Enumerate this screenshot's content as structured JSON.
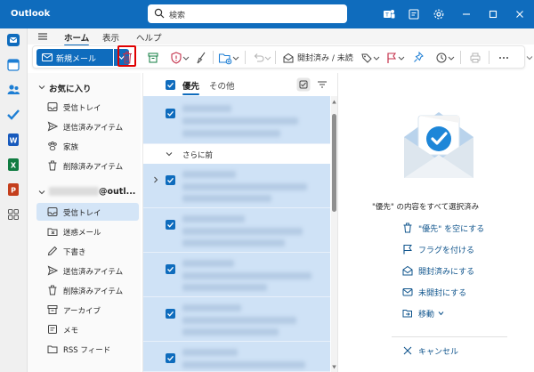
{
  "app": {
    "title": "Outlook"
  },
  "search": {
    "placeholder": "検索"
  },
  "ribbon": {
    "tabs": [
      "ホーム",
      "表示",
      "ヘルプ"
    ]
  },
  "toolbar": {
    "new_mail_label": "新規メール",
    "read_unread_label": "開封済み / 未読"
  },
  "folders": {
    "favorites_label": "お気に入り",
    "favorites": [
      "受信トレイ",
      "送信済みアイテム",
      "家族",
      "削除済みアイテム"
    ],
    "account_suffix": "@outl...",
    "account_items": [
      "受信トレイ",
      "迷惑メール",
      "下書き",
      "送信済みアイテム",
      "削除済みアイテム",
      "アーカイブ",
      "メモ",
      "RSS フィード"
    ]
  },
  "list": {
    "tabs": [
      "優先",
      "その他"
    ],
    "section_label": "さらに前"
  },
  "reading": {
    "selected_message": "\"優先\" の内容をすべて選択済み",
    "actions": {
      "empty": "\"優先\" を空にする",
      "flag": "フラグを付ける",
      "mark_read": "開封済みにする",
      "mark_unread": "未開封にする",
      "move": "移動",
      "cancel": "キャンセル"
    }
  },
  "colors": {
    "accent": "#0f6cbd",
    "selection": "#cfe2f6",
    "highlight_border": "#e00000"
  }
}
